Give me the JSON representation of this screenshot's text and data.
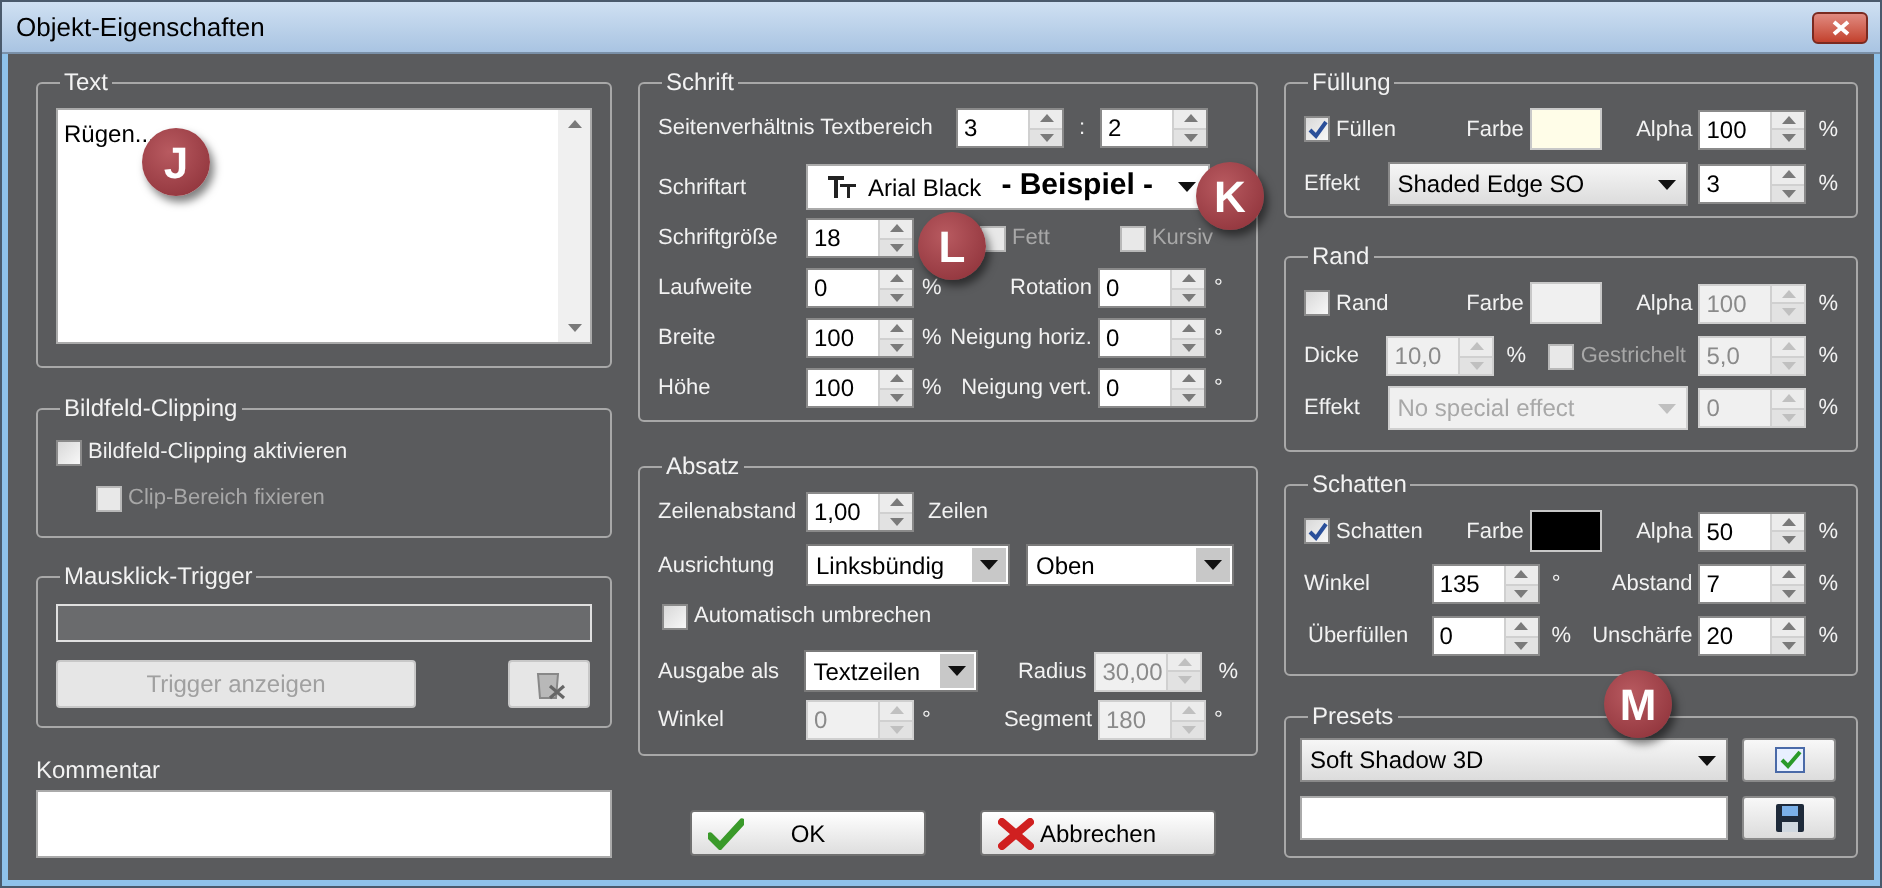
{
  "window": {
    "title": "Objekt-Eigenschaften"
  },
  "text_group": {
    "legend": "Text",
    "value": "Rügen..."
  },
  "clipping": {
    "legend": "Bildfeld-Clipping",
    "options": [
      {
        "label": "Bildfeld-Clipping aktivieren",
        "checked": false,
        "disabled": false
      },
      {
        "label": "Clip-Bereich fixieren",
        "checked": false,
        "disabled": true
      }
    ]
  },
  "trigger": {
    "legend": "Mausklick-Trigger",
    "button": {
      "label": "Trigger anzeigen",
      "disabled": true
    }
  },
  "comment": {
    "label": "Kommentar"
  },
  "font": {
    "legend": "Schrift",
    "aspect": {
      "label": "Seitenverhältnis Textbereich",
      "width": {
        "value": "3",
        "disabled": false
      },
      "separator": ":",
      "height": {
        "value": "2",
        "disabled": false
      }
    },
    "family": {
      "label": "Schriftart",
      "value": "Arial Black",
      "sample": "- Beispiel -"
    },
    "size": {
      "label": "Schriftgröße",
      "field": {
        "value": "18",
        "disabled": false
      }
    },
    "styles": [
      {
        "label": "Fett",
        "checked": false,
        "disabled": true
      },
      {
        "label": "Kursiv",
        "checked": false,
        "disabled": true
      }
    ],
    "rows": [
      {
        "label": "Laufweite",
        "field": {
          "value": "0",
          "disabled": false
        },
        "unit": "%",
        "label_2": "Rotation",
        "field_2": {
          "value": "0",
          "disabled": false
        },
        "unit_2": "°"
      },
      {
        "label": "Breite",
        "field": {
          "value": "100",
          "disabled": false
        },
        "unit": "%",
        "label_2": "Neigung horiz.",
        "field_2": {
          "value": "0",
          "disabled": false
        },
        "unit_2": "°"
      },
      {
        "label": "Höhe",
        "field": {
          "value": "100",
          "disabled": false
        },
        "unit": "%",
        "label_2": "Neigung vert.",
        "field_2": {
          "value": "0",
          "disabled": false
        },
        "unit_2": "°"
      }
    ]
  },
  "paragraph": {
    "legend": "Absatz",
    "spacing": {
      "label": "Zeilenabstand",
      "field": {
        "value": "1,00",
        "disabled": false
      },
      "unit": "Zeilen"
    },
    "alignment": {
      "label": "Ausrichtung",
      "horizontal": "Linksbündig",
      "vertical": "Oben"
    },
    "wrap": {
      "label": "Automatisch umbrechen",
      "checked": false,
      "disabled": false
    },
    "output": {
      "label": "Ausgabe als",
      "value": "Textzeilen"
    },
    "radius": {
      "label": "Radius",
      "field": {
        "value": "30,00",
        "disabled": true
      },
      "unit": "%"
    },
    "angle": {
      "label": "Winkel",
      "field": {
        "value": "0",
        "disabled": true
      },
      "unit": "°"
    },
    "segment": {
      "label": "Segment",
      "field": {
        "value": "180",
        "disabled": true
      },
      "unit": "°"
    }
  },
  "buttons": [
    {
      "label": "OK",
      "kind": "confirm"
    },
    {
      "label": "Abbrechen",
      "kind": "cancel"
    }
  ],
  "fill": {
    "legend": "Füllung",
    "enable": {
      "label": "Füllen",
      "checked": true,
      "disabled": false
    },
    "color": {
      "label": "Farbe",
      "color": "#fffde8"
    },
    "alpha": {
      "label": "Alpha",
      "field": {
        "value": "100",
        "disabled": false
      },
      "unit": "%"
    },
    "effect": {
      "label": "Effekt",
      "value": "Shaded Edge SO",
      "disabled": false
    },
    "effect_amount": {
      "field": {
        "value": "3",
        "disabled": false
      },
      "unit": "%"
    }
  },
  "border": {
    "legend": "Rand",
    "enable": {
      "label": "Rand",
      "checked": false,
      "disabled": false
    },
    "color": {
      "label": "Farbe",
      "color": "#f0f0f0"
    },
    "alpha": {
      "label": "Alpha",
      "field": {
        "value": "100",
        "disabled": true
      },
      "unit": "%"
    },
    "thickness": {
      "label": "Dicke",
      "field": {
        "value": "10,0",
        "disabled": true
      },
      "unit": "%"
    },
    "dashed": {
      "label": "Gestrichelt",
      "checked": false,
      "disabled": true
    },
    "dash": {
      "field": {
        "value": "5,0",
        "disabled": true
      },
      "unit": "%"
    },
    "effect": {
      "label": "Effekt",
      "value": "No special effect",
      "disabled": true
    },
    "effect_amount": {
      "field": {
        "value": "0",
        "disabled": true
      },
      "unit": "%"
    }
  },
  "shadow": {
    "legend": "Schatten",
    "enable": {
      "label": "Schatten",
      "checked": true,
      "disabled": false
    },
    "color": {
      "label": "Farbe",
      "color": "#000000"
    },
    "alpha": {
      "label": "Alpha",
      "field": {
        "value": "50",
        "disabled": false
      },
      "unit": "%"
    },
    "angle": {
      "label": "Winkel",
      "field": {
        "value": "135",
        "disabled": false
      },
      "unit": "°"
    },
    "distance": {
      "label": "Abstand",
      "field": {
        "value": "7",
        "disabled": false
      },
      "unit": "%"
    },
    "spread": {
      "label": "Überfüllen",
      "field": {
        "value": "0",
        "disabled": false
      },
      "unit": "%"
    },
    "blur": {
      "label": "Unschärfe",
      "field": {
        "value": "20",
        "disabled": false
      },
      "unit": "%"
    }
  },
  "presets": {
    "legend": "Presets",
    "value": "Soft Shadow 3D"
  },
  "annotations": [
    {
      "label": "J"
    },
    {
      "label": "K"
    },
    {
      "label": "L"
    },
    {
      "label": "M"
    }
  ]
}
